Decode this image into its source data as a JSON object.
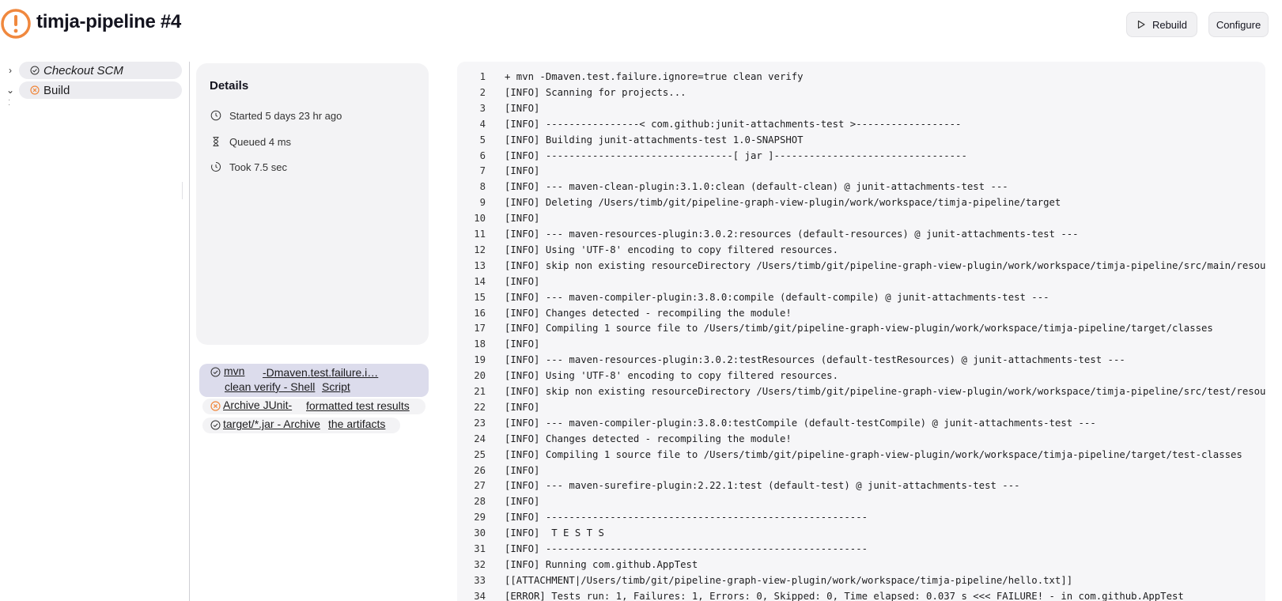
{
  "header": {
    "title": "timja-pipeline #4",
    "status_icon": "warning-circle-icon",
    "status_color": "#f0883e",
    "rebuild_label": "Rebuild",
    "configure_label": "Configure"
  },
  "stages": [
    {
      "label": "Checkout SCM",
      "status": "success",
      "expanded": false
    },
    {
      "label": "Build",
      "status": "failed",
      "expanded": true
    }
  ],
  "details": {
    "title": "Details",
    "started": "Started 5 days 23 hr ago",
    "queued": "Queued 4 ms",
    "took": "Took 7.5 sec"
  },
  "steps": [
    {
      "status": "success",
      "line1a": "mvn",
      "line1b": "-Dmaven.test.failure.i…",
      "line2a": "clean verify - Shell",
      "line2b": "Script"
    },
    {
      "status": "failed",
      "line1a": "Archive JUnit-",
      "line1b": "formatted test results"
    },
    {
      "status": "success",
      "line1a": "target/*.jar - Archive",
      "line1b": "the artifacts"
    }
  ],
  "colors": {
    "failed": "#f0883e",
    "accent_bg": "#dcdcec"
  },
  "console": {
    "lines": [
      {
        "n": "1",
        "t": "+ mvn -Dmaven.test.failure.ignore=true clean verify"
      },
      {
        "n": "2",
        "t": "[INFO] Scanning for projects..."
      },
      {
        "n": "3",
        "t": "[INFO]"
      },
      {
        "n": "4",
        "t": "[INFO] ----------------< com.github:junit-attachments-test >------------------"
      },
      {
        "n": "5",
        "t": "[INFO] Building junit-attachments-test 1.0-SNAPSHOT"
      },
      {
        "n": "6",
        "t": "[INFO] --------------------------------[ jar ]---------------------------------"
      },
      {
        "n": "7",
        "t": "[INFO]"
      },
      {
        "n": "8",
        "t": "[INFO] --- maven-clean-plugin:3.1.0:clean (default-clean) @ junit-attachments-test ---"
      },
      {
        "n": "9",
        "t": "[INFO] Deleting /Users/timb/git/pipeline-graph-view-plugin/work/workspace/timja-pipeline/target"
      },
      {
        "n": "10",
        "t": "[INFO]"
      },
      {
        "n": "11",
        "t": "[INFO] --- maven-resources-plugin:3.0.2:resources (default-resources) @ junit-attachments-test ---"
      },
      {
        "n": "12",
        "t": "[INFO] Using 'UTF-8' encoding to copy filtered resources."
      },
      {
        "n": "13",
        "t": "[INFO] skip non existing resourceDirectory /Users/timb/git/pipeline-graph-view-plugin/work/workspace/timja-pipeline/src/main/resources"
      },
      {
        "n": "14",
        "t": "[INFO]"
      },
      {
        "n": "15",
        "t": "[INFO] --- maven-compiler-plugin:3.8.0:compile (default-compile) @ junit-attachments-test ---"
      },
      {
        "n": "16",
        "t": "[INFO] Changes detected - recompiling the module!"
      },
      {
        "n": "17",
        "t": "[INFO] Compiling 1 source file to /Users/timb/git/pipeline-graph-view-plugin/work/workspace/timja-pipeline/target/classes"
      },
      {
        "n": "18",
        "t": "[INFO]"
      },
      {
        "n": "19",
        "t": "[INFO] --- maven-resources-plugin:3.0.2:testResources (default-testResources) @ junit-attachments-test ---"
      },
      {
        "n": "20",
        "t": "[INFO] Using 'UTF-8' encoding to copy filtered resources."
      },
      {
        "n": "21",
        "t": "[INFO] skip non existing resourceDirectory /Users/timb/git/pipeline-graph-view-plugin/work/workspace/timja-pipeline/src/test/resources"
      },
      {
        "n": "22",
        "t": "[INFO]"
      },
      {
        "n": "23",
        "t": "[INFO] --- maven-compiler-plugin:3.8.0:testCompile (default-testCompile) @ junit-attachments-test ---"
      },
      {
        "n": "24",
        "t": "[INFO] Changes detected - recompiling the module!"
      },
      {
        "n": "25",
        "t": "[INFO] Compiling 1 source file to /Users/timb/git/pipeline-graph-view-plugin/work/workspace/timja-pipeline/target/test-classes"
      },
      {
        "n": "26",
        "t": "[INFO]"
      },
      {
        "n": "27",
        "t": "[INFO] --- maven-surefire-plugin:2.22.1:test (default-test) @ junit-attachments-test ---"
      },
      {
        "n": "28",
        "t": "[INFO]"
      },
      {
        "n": "29",
        "t": "[INFO] -------------------------------------------------------"
      },
      {
        "n": "30",
        "t": "[INFO]  T E S T S"
      },
      {
        "n": "31",
        "t": "[INFO] -------------------------------------------------------"
      },
      {
        "n": "32",
        "t": "[INFO] Running com.github.AppTest"
      },
      {
        "n": "33",
        "t": "[[ATTACHMENT|/Users/timb/git/pipeline-graph-view-plugin/work/workspace/timja-pipeline/hello.txt]]"
      },
      {
        "n": "34",
        "t": "[ERROR] Tests run: 1, Failures: 1, Errors: 0, Skipped: 0, Time elapsed: 0.037 s <<< FAILURE! - in com.github.AppTest"
      }
    ]
  }
}
